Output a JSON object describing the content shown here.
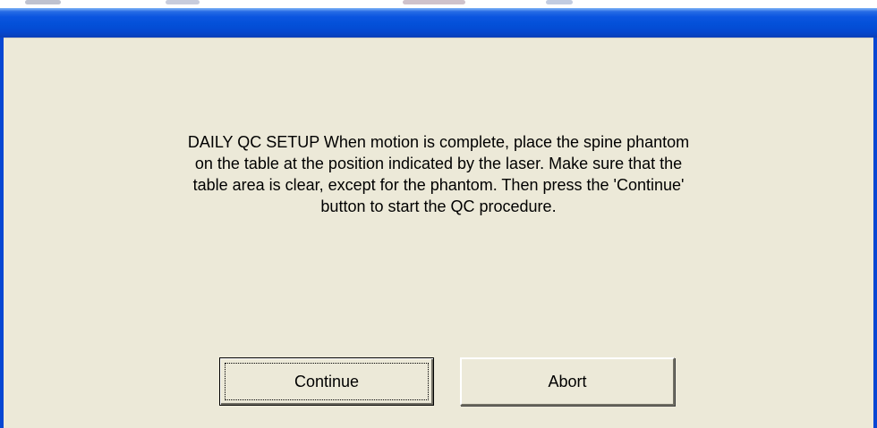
{
  "dialog": {
    "title": "",
    "message": "DAILY QC SETUP  When motion is complete, place the spine phantom\non the table at the position indicated by the laser.  Make sure that the\ntable area is clear, except for the phantom.  Then press the 'Continue'\nbutton to start the QC procedure.",
    "buttons": {
      "continue_label": "Continue",
      "abort_label": "Abort"
    }
  },
  "colors": {
    "titlebar": "#0450d8",
    "client_background": "#ece9d8",
    "frame": "#0747d3"
  }
}
